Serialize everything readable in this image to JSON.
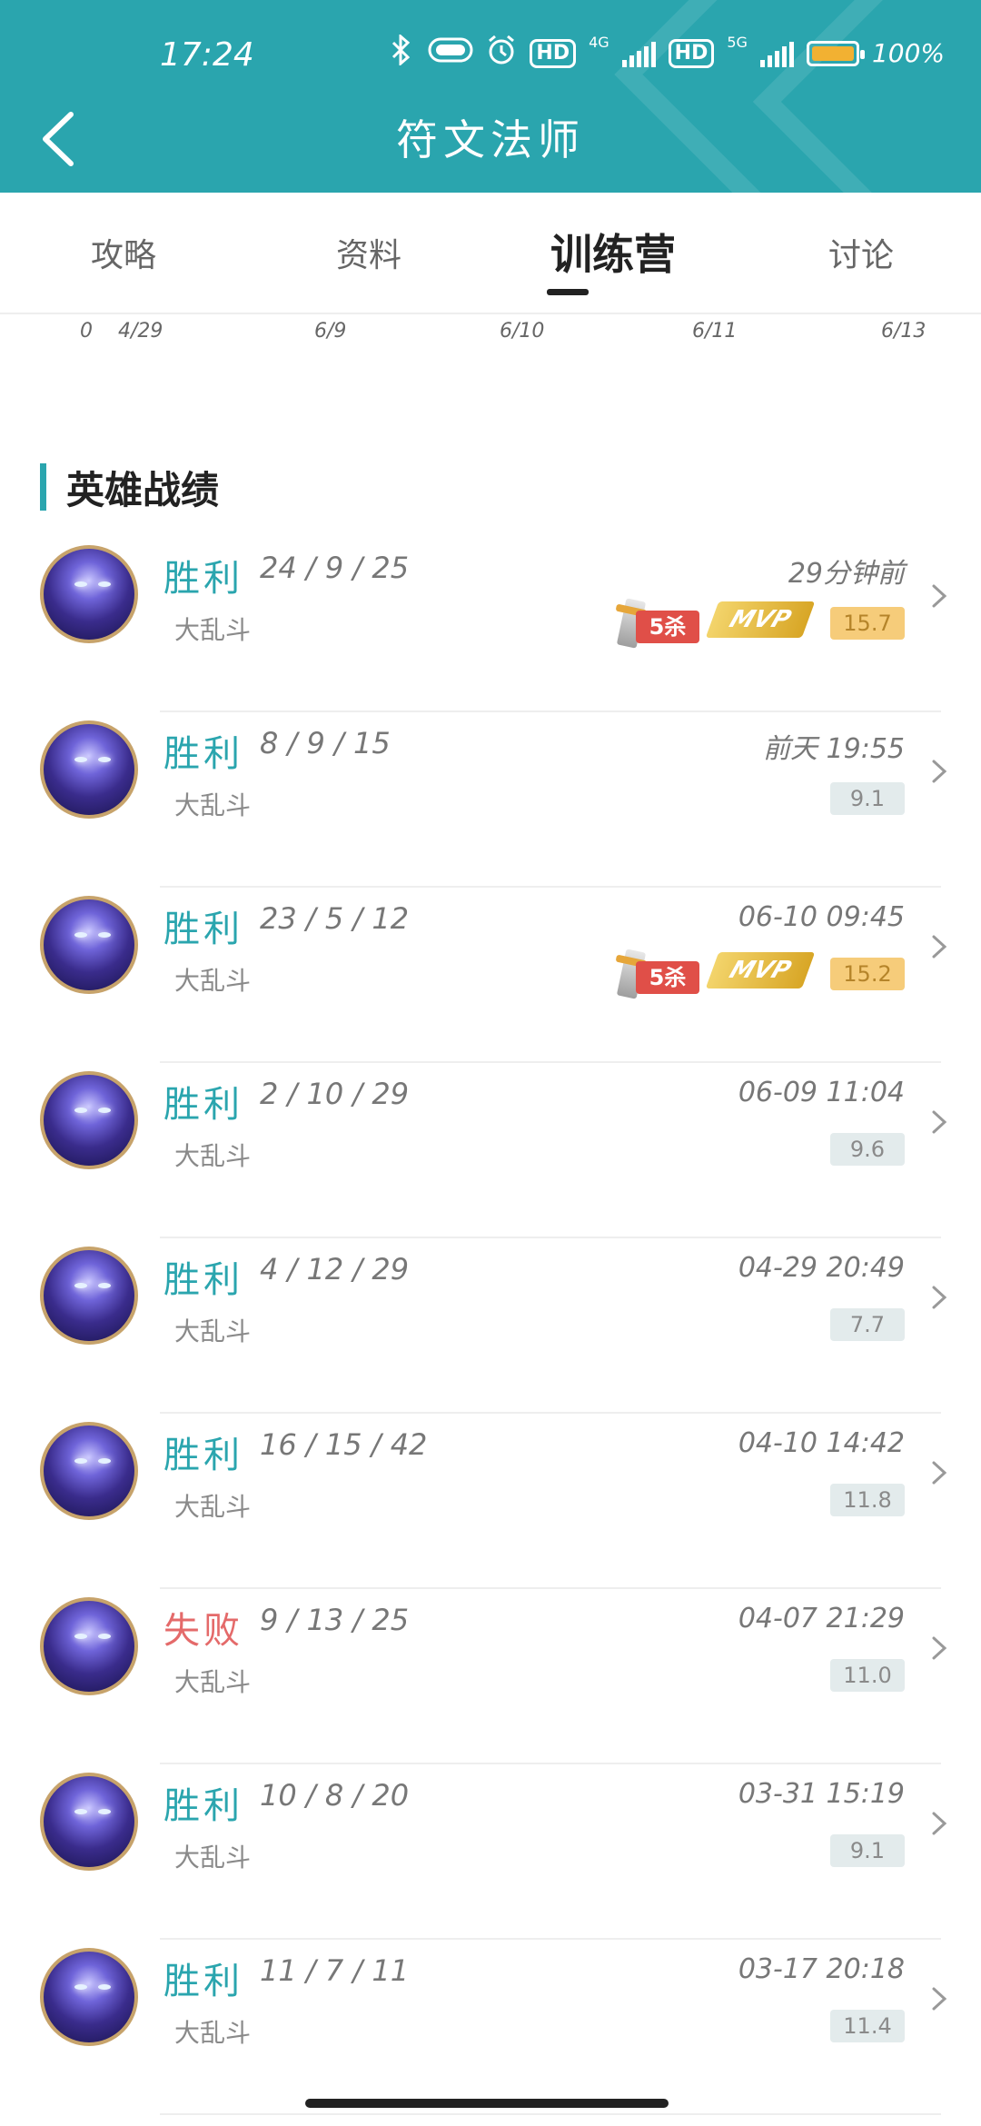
{
  "status_bar": {
    "time": "17:24",
    "hd_label": "HD",
    "net_4g": "4G",
    "net_5g": "5G",
    "battery": "100%",
    "icons": [
      "bluetooth-icon",
      "toggle-icon",
      "alarm-icon",
      "signal-icon",
      "battery-icon"
    ]
  },
  "header": {
    "title": "符文法师",
    "back_icon": "chevron-left-icon"
  },
  "tabs": [
    {
      "label": "攻略"
    },
    {
      "label": "资料"
    },
    {
      "label": "训练营"
    },
    {
      "label": "讨论"
    }
  ],
  "timeline_axis": [
    "0",
    "4/29",
    "6/9",
    "6/10",
    "6/11",
    "6/13"
  ],
  "section": {
    "title": "英雄战绩"
  },
  "matches": [
    {
      "result": "胜利",
      "kda": "24 / 9 / 25",
      "time": "29分钟前",
      "mode": "大乱斗",
      "score": "15.7",
      "badges": [
        "5杀",
        "MVP"
      ]
    },
    {
      "result": "胜利",
      "kda": "8 / 9 / 15",
      "time": "前天 19:55",
      "mode": "大乱斗",
      "score": "9.1",
      "badges": []
    },
    {
      "result": "胜利",
      "kda": "23 / 5 / 12",
      "time": "06-10 09:45",
      "mode": "大乱斗",
      "score": "15.2",
      "badges": [
        "5杀",
        "MVP"
      ]
    },
    {
      "result": "胜利",
      "kda": "2 / 10 / 29",
      "time": "06-09 11:04",
      "mode": "大乱斗",
      "score": "9.6",
      "badges": []
    },
    {
      "result": "胜利",
      "kda": "4 / 12 / 29",
      "time": "04-29 20:49",
      "mode": "大乱斗",
      "score": "7.7",
      "badges": []
    },
    {
      "result": "胜利",
      "kda": "16 / 15 / 42",
      "time": "04-10 14:42",
      "mode": "大乱斗",
      "score": "11.8",
      "badges": []
    },
    {
      "result": "失败",
      "kda": "9 / 13 / 25",
      "time": "04-07 21:29",
      "mode": "大乱斗",
      "score": "11.0",
      "badges": []
    },
    {
      "result": "胜利",
      "kda": "10 / 8 / 20",
      "time": "03-31 15:19",
      "mode": "大乱斗",
      "score": "9.1",
      "badges": []
    },
    {
      "result": "胜利",
      "kda": "11 / 7 / 11",
      "time": "03-17 20:18",
      "mode": "大乱斗",
      "score": "11.4",
      "badges": []
    }
  ],
  "colors": {
    "accent": "#2aa5ae",
    "win": "#2aa5ae",
    "lose": "#e46a6a",
    "score_gold": "#f6cc7a"
  }
}
